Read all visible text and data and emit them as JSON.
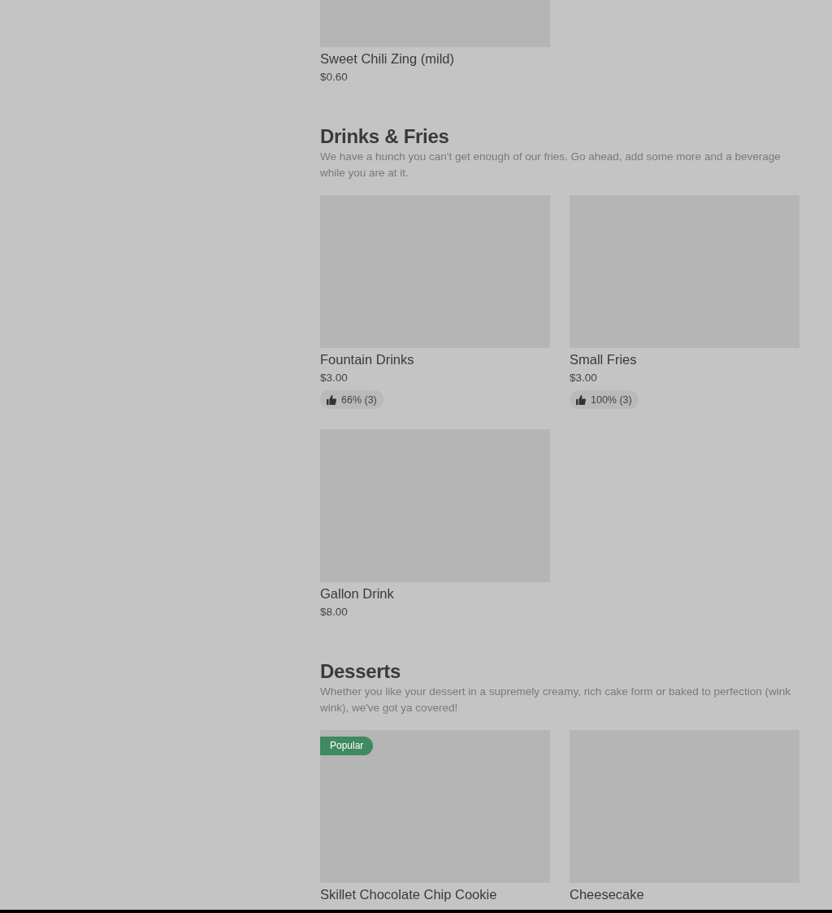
{
  "sections": [
    {
      "items": [
        {
          "name": "Sweet Chili Zing (mild)",
          "price": "$0.60"
        }
      ]
    },
    {
      "title": "Drinks & Fries",
      "description": "We have a hunch you can't get enough of our fries. Go ahead, add some more and a beverage while you are at it.",
      "items": [
        {
          "name": "Fountain Drinks",
          "price": "$3.00",
          "rating": "66% (3)"
        },
        {
          "name": "Small Fries",
          "price": "$3.00",
          "rating": "100% (3)"
        },
        {
          "name": "Gallon Drink",
          "price": "$8.00"
        }
      ]
    },
    {
      "title": "Desserts",
      "description": "Whether you like your dessert in a supremely creamy, rich cake form or baked to perfection (wink wink), we've got ya covered!",
      "items": [
        {
          "name": "Skillet Chocolate Chip Cookie",
          "badge": "Popular"
        },
        {
          "name": "Cheesecake"
        }
      ]
    }
  ]
}
